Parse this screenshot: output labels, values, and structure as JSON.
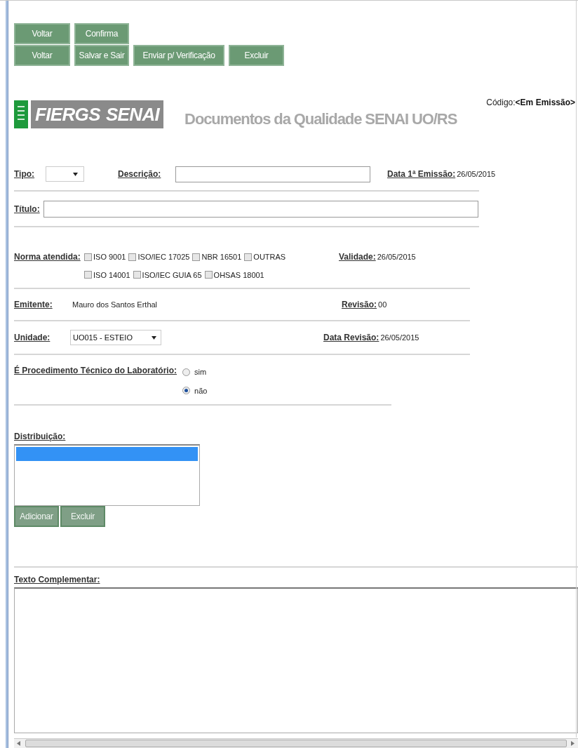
{
  "toolbar": {
    "rows": [
      [
        {
          "label": "Voltar"
        },
        {
          "label": "Confirma"
        }
      ],
      [
        {
          "label": "Voltar"
        },
        {
          "label": "Salvar e Sair"
        },
        {
          "label": "Enviar p/ Verificação"
        },
        {
          "label": "Excluir"
        }
      ]
    ]
  },
  "header": {
    "logo_words": [
      "FIERGS",
      "SENAI"
    ],
    "title": "Documentos da Qualidade SENAI UO/RS",
    "code_label": "Código:",
    "code_value": "<Em Emissão>"
  },
  "tipo": {
    "label": "Tipo:"
  },
  "descricao": {
    "label": "Descrição:"
  },
  "data_emissao": {
    "label": "Data 1ª Emissão:",
    "value": "26/05/2015"
  },
  "titulo": {
    "label": "Título:"
  },
  "norma": {
    "label": "Norma atendida:",
    "rows": [
      [
        {
          "label": "ISO 9001",
          "checked": false
        },
        {
          "label": "ISO/IEC 17025",
          "checked": false
        },
        {
          "label": "NBR 16501",
          "checked": false
        },
        {
          "label": "OUTRAS",
          "checked": false
        }
      ],
      [
        {
          "label": "ISO 14001",
          "checked": false
        },
        {
          "label": "ISO/IEC GUIA 65",
          "checked": false
        },
        {
          "label": "OHSAS 18001",
          "checked": false
        }
      ]
    ]
  },
  "validade": {
    "label": "Validade:",
    "value": "26/05/2015"
  },
  "emitente": {
    "label": "Emitente:",
    "value": "Mauro dos Santos Erthal"
  },
  "revisao": {
    "label": "Revisão:",
    "value": "00"
  },
  "unidade": {
    "label": "Unidade:",
    "value": "UO015 - ESTEIO"
  },
  "data_revisao": {
    "label": "Data Revisão:",
    "value": "26/05/2015"
  },
  "procedimento": {
    "label": "É Procedimento Técnico do Laboratório:",
    "options": [
      {
        "label": "sim",
        "selected": false
      },
      {
        "label": "não",
        "selected": true
      }
    ]
  },
  "distribuicao": {
    "label": "Distribuição:",
    "rows": [
      {
        "selected": true
      }
    ],
    "buttons": [
      {
        "label": "Adicionar",
        "disabled": true
      },
      {
        "label": "Excluir",
        "disabled": true
      }
    ]
  },
  "texto_complementar": {
    "label": "Texto Complementar:"
  }
}
